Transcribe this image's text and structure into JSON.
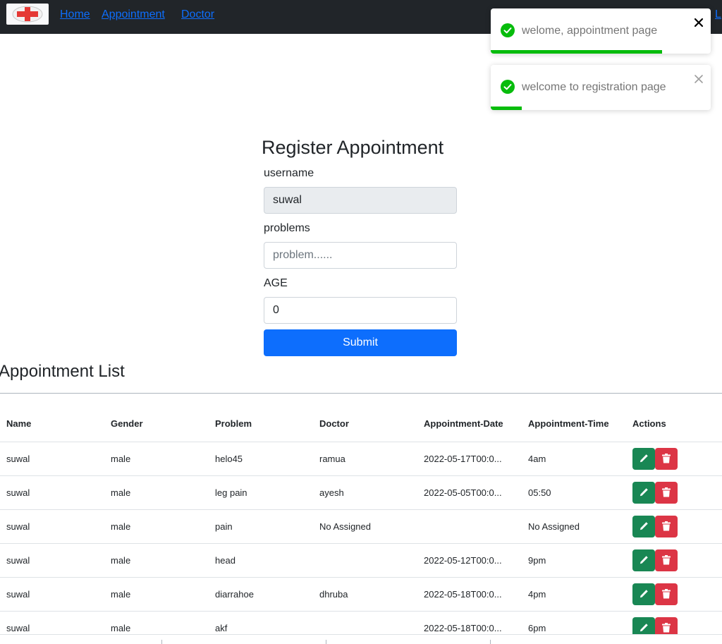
{
  "nav": {
    "links": [
      "Home",
      "Appointment",
      "Doctor"
    ],
    "right_link": "L"
  },
  "toasts": [
    {
      "message": "welome, appointment page",
      "progress": 0.78
    },
    {
      "message": "welcome to registration page",
      "progress": 0.14
    }
  ],
  "form": {
    "title": "Register Appointment",
    "username_label": "username",
    "username_value": "suwal",
    "problems_label": "problems",
    "problems_placeholder": "problem......",
    "age_label": "AGE",
    "age_value": "0",
    "submit_label": "Submit"
  },
  "list": {
    "title": "Appointment List",
    "columns": [
      "Name",
      "Gender",
      "Problem",
      "Doctor",
      "Appointment-Date",
      "Appointment-Time",
      "Actions"
    ],
    "rows": [
      [
        "suwal",
        "male",
        "helo45",
        "ramua",
        "2022-05-17T00:0...",
        "4am"
      ],
      [
        "suwal",
        "male",
        "leg pain",
        "ayesh",
        "2022-05-05T00:0...",
        "05:50"
      ],
      [
        "suwal",
        "male",
        "pain",
        "No Assigned",
        "",
        "No Assigned"
      ],
      [
        "suwal",
        "male",
        "head",
        "",
        "2022-05-12T00:0...",
        "9pm"
      ],
      [
        "suwal",
        "male",
        "diarrahoe",
        "dhruba",
        "2022-05-18T00:0...",
        "4pm"
      ],
      [
        "suwal",
        "male",
        "akf",
        "",
        "2022-05-18T00:0...",
        "6pm"
      ]
    ]
  },
  "colors": {
    "navbar": "#212529",
    "link": "#0d6efd",
    "success": "#07bc0c",
    "edit": "#198754",
    "delete": "#dc3545"
  },
  "icons": {
    "logo": "red-cross-logo",
    "toast": "check-circle-icon",
    "close": "close-icon",
    "edit": "pencil-icon",
    "delete": "trash-icon"
  }
}
